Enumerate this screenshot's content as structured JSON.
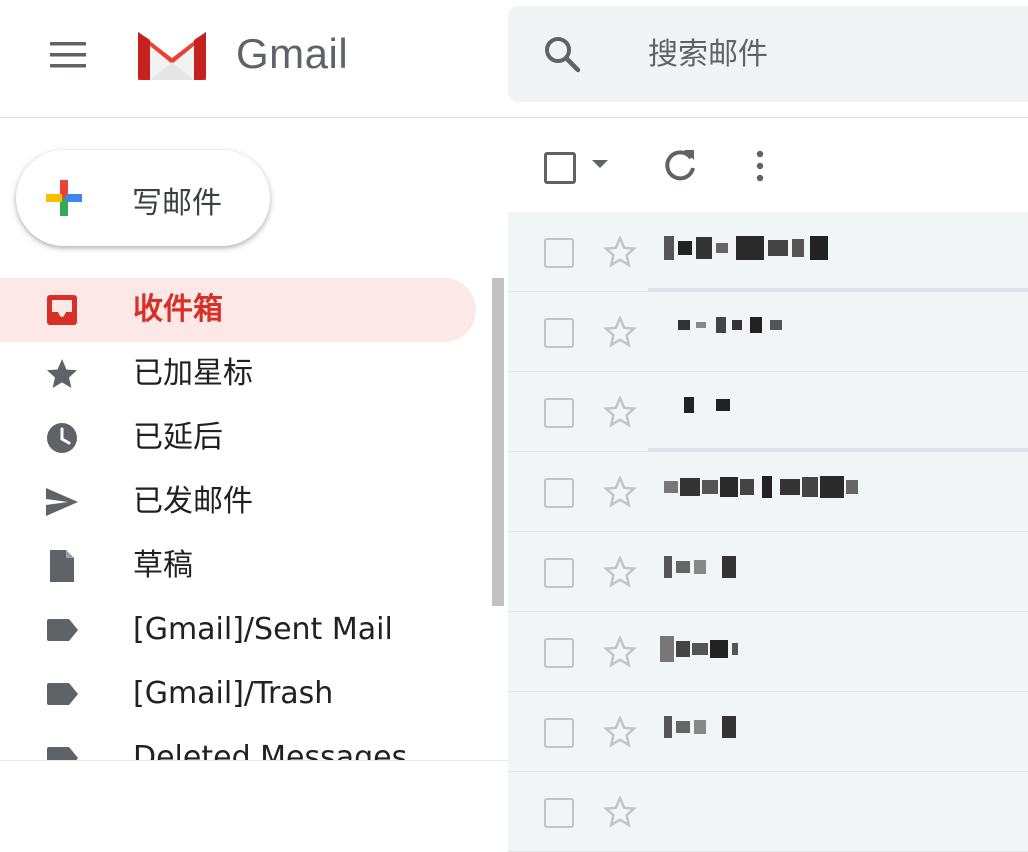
{
  "header": {
    "brand": "Gmail",
    "search_placeholder": "搜索邮件",
    "icons": [
      "menu-icon",
      "gmail-logo",
      "search-icon"
    ]
  },
  "compose": {
    "label": "写邮件",
    "icon": "compose-plus-icon"
  },
  "sidebar": {
    "items": [
      {
        "label": "收件箱",
        "icon": "inbox-icon",
        "active": true
      },
      {
        "label": "已加星标",
        "icon": "star-icon",
        "active": false
      },
      {
        "label": "已延后",
        "icon": "clock-icon",
        "active": false
      },
      {
        "label": "已发邮件",
        "icon": "send-icon",
        "active": false
      },
      {
        "label": "草稿",
        "icon": "draft-icon",
        "active": false
      },
      {
        "label": "[Gmail]/Sent Mail",
        "icon": "label-icon",
        "active": false
      },
      {
        "label": "[Gmail]/Trash",
        "icon": "label-icon",
        "active": false
      },
      {
        "label": "Deleted Messages",
        "icon": "label-icon",
        "active": false
      }
    ]
  },
  "toolbar": {
    "icons": [
      "select-all-checkbox",
      "select-caret-icon",
      "refresh-icon",
      "more-vert-icon"
    ]
  },
  "colors": {
    "active_bg": "#fce8e6",
    "active_text": "#d93025",
    "list_bg": "#f2f5f5"
  }
}
